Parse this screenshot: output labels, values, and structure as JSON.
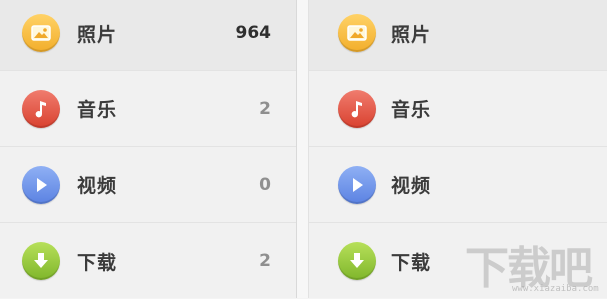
{
  "left_panel": {
    "items": [
      {
        "label": "照片",
        "count": "964",
        "icon": "photo-icon",
        "color": "#f2ae2b"
      },
      {
        "label": "音乐",
        "count": "2",
        "icon": "music-note-icon",
        "color": "#d9412f"
      },
      {
        "label": "视频",
        "count": "0",
        "icon": "play-icon",
        "color": "#5b82e2"
      },
      {
        "label": "下载",
        "count": "2",
        "icon": "download-arrow-icon",
        "color": "#7fb62b"
      }
    ]
  },
  "right_panel": {
    "items": [
      {
        "label": "照片",
        "icon": "photo-icon"
      },
      {
        "label": "音乐",
        "icon": "music-note-icon"
      },
      {
        "label": "视频",
        "icon": "play-icon"
      },
      {
        "label": "下载",
        "icon": "download-arrow-icon"
      }
    ]
  },
  "watermark": {
    "text": "下载吧",
    "url": "www.xiazaiba.com"
  }
}
